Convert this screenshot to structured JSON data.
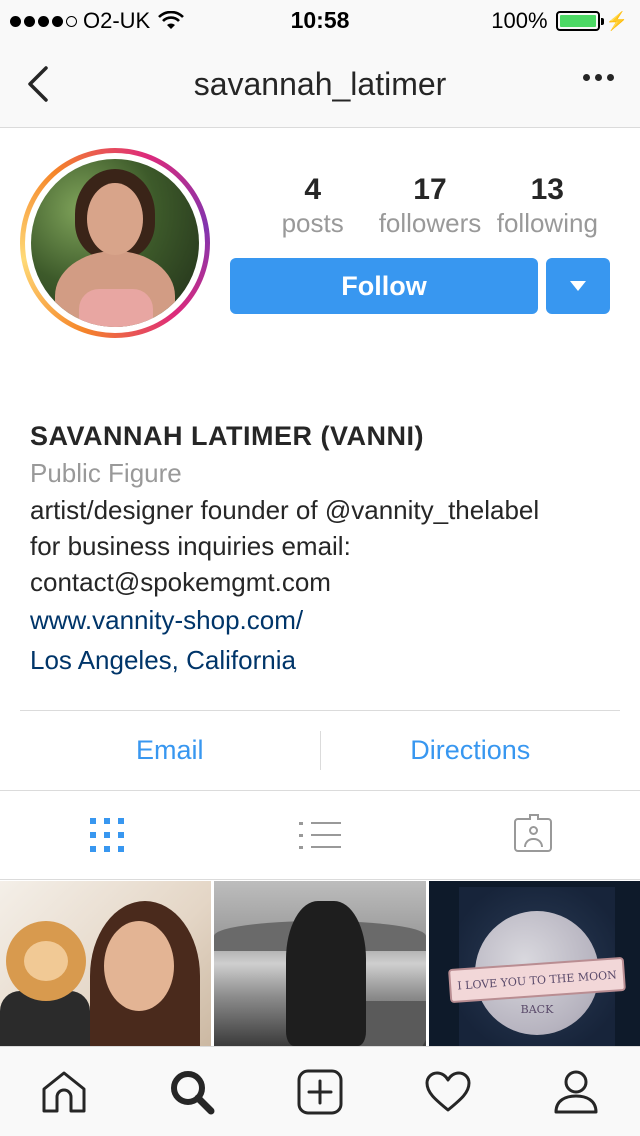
{
  "status_bar": {
    "carrier": "O2-UK",
    "time": "10:58",
    "battery": "100%",
    "battery_level": 1.0,
    "signal_bars": 4
  },
  "nav": {
    "title": "savannah_latimer",
    "back_icon": "chevron-left-icon",
    "more_icon": "more-horizontal-icon"
  },
  "profile": {
    "stats": [
      {
        "number": "4",
        "label": "posts"
      },
      {
        "number": "17",
        "label": "followers"
      },
      {
        "number": "13",
        "label": "following"
      }
    ],
    "follow_label": "Follow",
    "dropdown_icon": "caret-down-icon"
  },
  "bio": {
    "name": "SAVANNAH LATIMER (VANNI)",
    "category": "Public Figure",
    "lines": [
      "artist/designer founder of @vannity_thelabel",
      "for business inquiries email:",
      "contact@spokemgmt.com"
    ],
    "website": "www.vannity-shop.com/",
    "location": "Los Angeles, California"
  },
  "contact": {
    "email_label": "Email",
    "directions_label": "Directions"
  },
  "view_tabs": {
    "active": "grid",
    "icons": [
      "grid-icon",
      "list-icon",
      "tagged-icon"
    ]
  },
  "posts": {
    "photo3_text_top": "I LOVE YOU TO THE MOON",
    "photo3_text_bottom": "BACK"
  },
  "tab_bar": {
    "icons": [
      "home-icon",
      "search-icon",
      "add-post-icon",
      "heart-icon",
      "profile-icon"
    ],
    "active": "search-icon"
  },
  "colors": {
    "accent": "#3897f0",
    "link": "#003569",
    "secondary_text": "#999999",
    "battery": "#4cd964"
  }
}
